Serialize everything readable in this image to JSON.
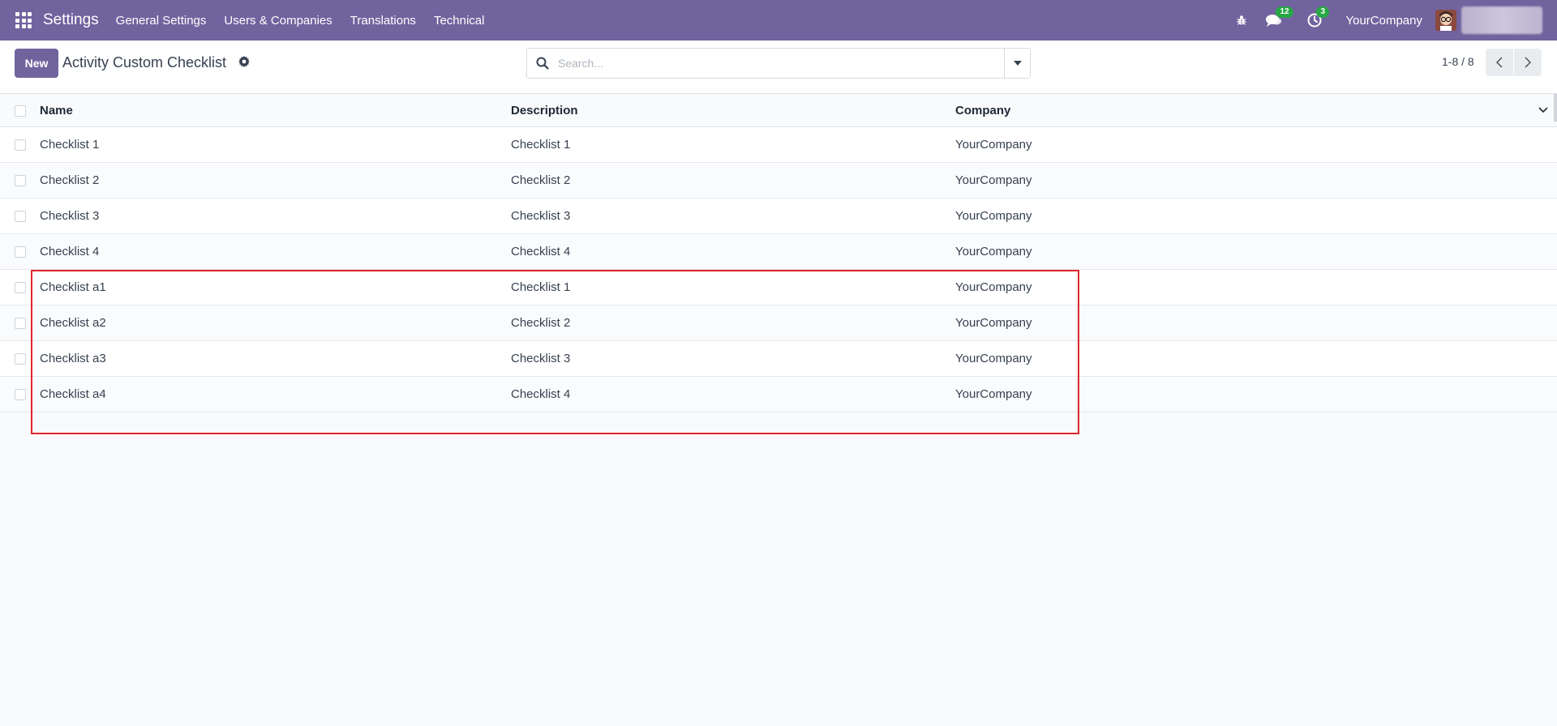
{
  "navbar": {
    "app_name": "Settings",
    "menu": [
      "General Settings",
      "Users & Companies",
      "Translations",
      "Technical"
    ],
    "messages_count": "12",
    "activities_count": "3",
    "company": "YourCompany",
    "accent": "#71639e",
    "icons": [
      "apps-grid-icon",
      "bug-icon",
      "chat-icon",
      "clock-icon"
    ]
  },
  "control_panel": {
    "new_label": "New",
    "title": "Activity Custom Checklist",
    "search_placeholder": "Search...",
    "pager": "1-8 / 8"
  },
  "table": {
    "columns": [
      "Name",
      "Description",
      "Company"
    ],
    "rows": [
      [
        "Checklist 1",
        "Checklist 1",
        "YourCompany"
      ],
      [
        "Checklist 2",
        "Checklist 2",
        "YourCompany"
      ],
      [
        "Checklist 3",
        "Checklist 3",
        "YourCompany"
      ],
      [
        "Checklist 4",
        "Checklist 4",
        "YourCompany"
      ],
      [
        "Checklist a1",
        "Checklist 1",
        "YourCompany"
      ],
      [
        "Checklist a2",
        "Checklist 2",
        "YourCompany"
      ],
      [
        "Checklist a3",
        "Checklist 3",
        "YourCompany"
      ],
      [
        "Checklist a4",
        "Checklist 4",
        "YourCompany"
      ]
    ]
  },
  "annotation": {
    "highlight_color": "#e0262a"
  }
}
